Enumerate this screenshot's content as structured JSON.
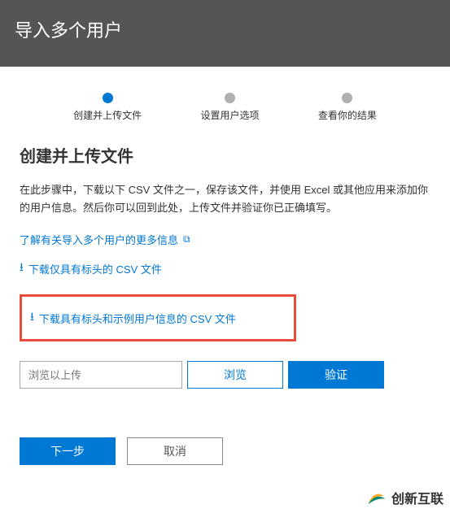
{
  "header": {
    "title": "导入多个用户"
  },
  "steps": [
    {
      "label": "创建并上传文件",
      "active": true
    },
    {
      "label": "设置用户选项",
      "active": false
    },
    {
      "label": "查看你的结果",
      "active": false
    }
  ],
  "section": {
    "title": "创建并上传文件",
    "description": "在此步骤中，下载以下 CSV 文件之一，保存该文件，并使用 Excel 或其他应用来添加你的用户信息。然后你可以回到此处，上传文件并验证你已正确填写。"
  },
  "links": {
    "learn_more": "了解有关导入多个用户的更多信息",
    "download_headers": "下载仅具有标头的 CSV 文件",
    "download_sample": "下载具有标头和示例用户信息的 CSV 文件"
  },
  "file": {
    "placeholder": "浏览以上传",
    "browse_label": "浏览",
    "validate_label": "验证"
  },
  "actions": {
    "next": "下一步",
    "cancel": "取消"
  },
  "watermark": {
    "text": "创新互联"
  }
}
